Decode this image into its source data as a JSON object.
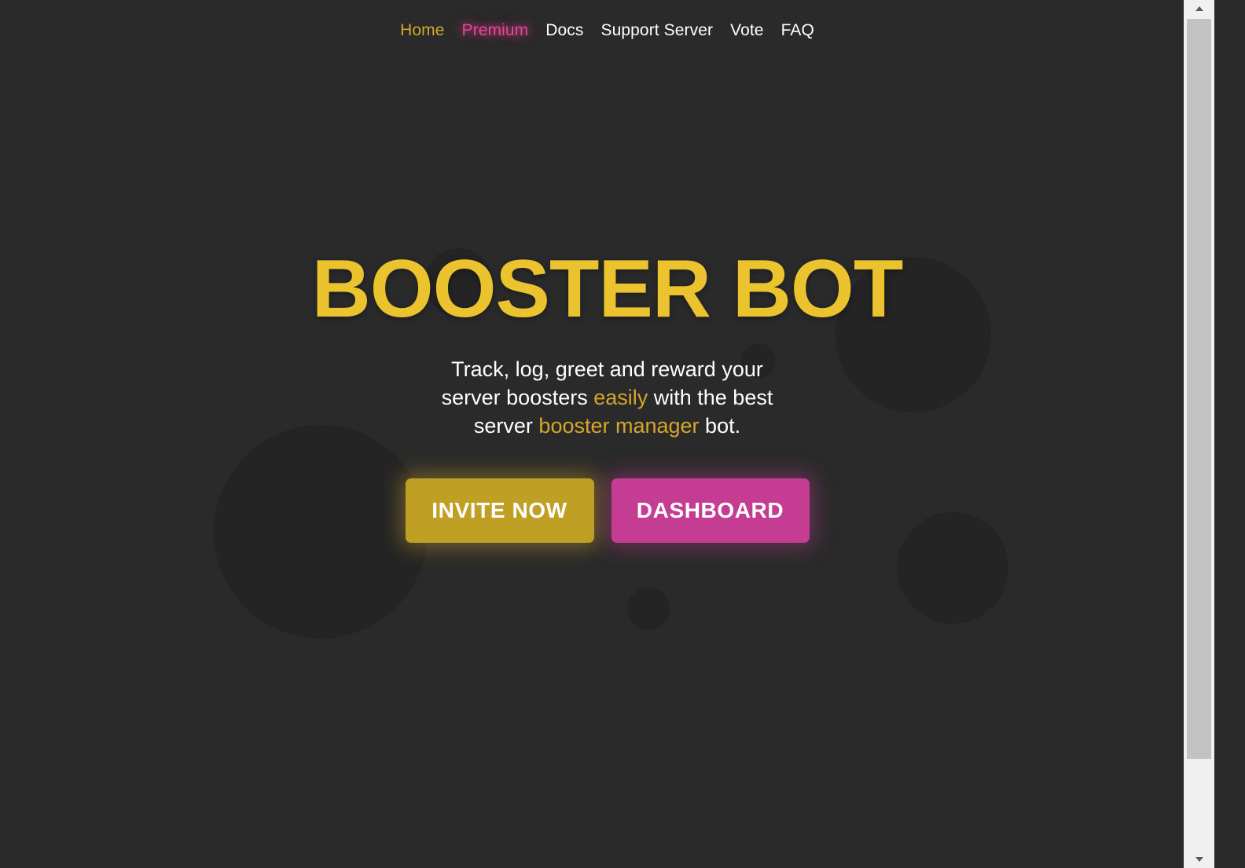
{
  "window": {
    "background_color": "#2a2a2a"
  },
  "nav": {
    "items": [
      {
        "label": "Home",
        "state": "active",
        "color": "#d4a72c"
      },
      {
        "label": "Premium",
        "state": "accent",
        "color": "#e8449a"
      },
      {
        "label": "Docs",
        "state": "default",
        "color": "#ffffff"
      },
      {
        "label": "Support Server",
        "state": "default",
        "color": "#ffffff"
      },
      {
        "label": "Vote",
        "state": "default",
        "color": "#ffffff"
      },
      {
        "label": "FAQ",
        "state": "default",
        "color": "#ffffff"
      }
    ]
  },
  "hero": {
    "title": "BOOSTER BOT",
    "title_color": "#ebc32e",
    "subtitle": {
      "line1_plain": "Track, log, greet and reward your",
      "line2_plain_a": "server boosters ",
      "line2_highlight": "easily",
      "line2_plain_b": " with the best",
      "line3_plain_a": "server ",
      "line3_highlight": "booster manager",
      "line3_plain_b": " bot.",
      "highlight_color": "#d4a72c"
    },
    "buttons": {
      "invite": {
        "label": "INVITE NOW",
        "color": "#c0a024",
        "glow": "#d4a72c"
      },
      "dashboard": {
        "label": "DASHBOARD",
        "color": "#c43d93",
        "glow": "#c43d93"
      }
    }
  },
  "scrollbar": {
    "up_arrow": "▲",
    "down_arrow": "▼"
  }
}
